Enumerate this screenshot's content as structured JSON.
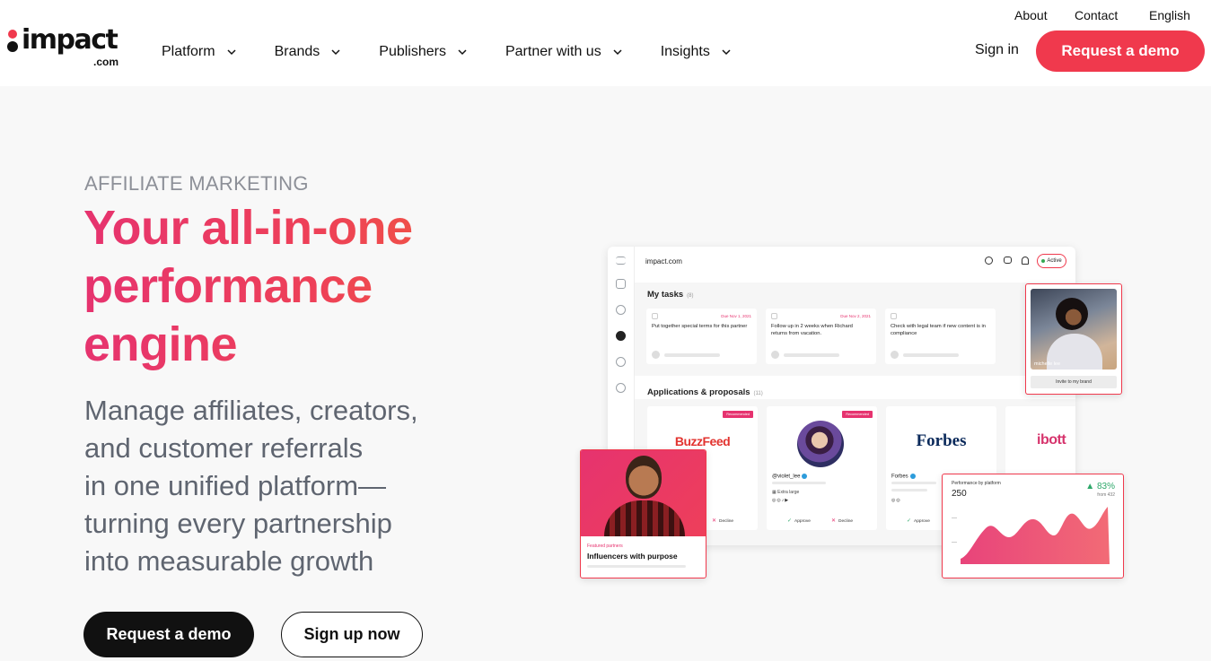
{
  "header": {
    "logo": {
      "word": "impact",
      "suffix": ".com"
    },
    "nav": [
      {
        "label": "Platform"
      },
      {
        "label": "Brands"
      },
      {
        "label": "Publishers"
      },
      {
        "label": "Partner with us"
      },
      {
        "label": "Insights"
      }
    ],
    "utility": {
      "about": "About",
      "contact": "Contact",
      "language": "English"
    },
    "sign_in": "Sign in",
    "request_demo": "Request a demo"
  },
  "hero": {
    "eyebrow": "AFFILIATE MARKETING",
    "headline_lines": [
      "Your all-in-one",
      "performance",
      "engine"
    ],
    "subhead_lines": [
      "Manage affiliates, creators,",
      "and customer referrals",
      "in one unified platform—",
      "turning every partnership",
      "into measurable growth"
    ],
    "cta_primary": "Request a demo",
    "cta_secondary": "Sign up now"
  },
  "dashboard": {
    "brand": "impact.com",
    "status": "Active",
    "tasks": {
      "title": "My tasks",
      "count": "(8)",
      "items": [
        {
          "due": "Due Nov 1, 2021",
          "text": "Put together special terms for this partner"
        },
        {
          "due": "Due Nov 2, 2021",
          "text": "Follow up in 2 weeks when Richard returns from vacation."
        },
        {
          "due": "",
          "text": "Check with legal team if new content is in compliance"
        }
      ]
    },
    "applications": {
      "title": "Applications & proposals",
      "count": "(11)",
      "recommended_label": "Recommended",
      "cards": [
        {
          "logo": "BuzzFeed",
          "decline": "Decline"
        },
        {
          "handle": "@violet_lee",
          "size": "Extra large",
          "approve": "Approve",
          "decline": "Decline"
        },
        {
          "logo": "Forbes",
          "name": "Forbes",
          "approve": "Approve"
        },
        {
          "logo": "ibott"
        }
      ]
    }
  },
  "invite_card": {
    "name": "michelle lee",
    "button": "Invite to my brand"
  },
  "featured_card": {
    "label": "Featured partners",
    "title": "Influencers with purpose"
  },
  "performance_card": {
    "label": "Performance by platform",
    "value": "250",
    "change": "▲ 83%",
    "from": "from 432"
  },
  "colors": {
    "brand": "#f0394d",
    "headline_from": "#e6336f",
    "headline_to": "#f15e3b",
    "text_muted": "#5f6570"
  }
}
